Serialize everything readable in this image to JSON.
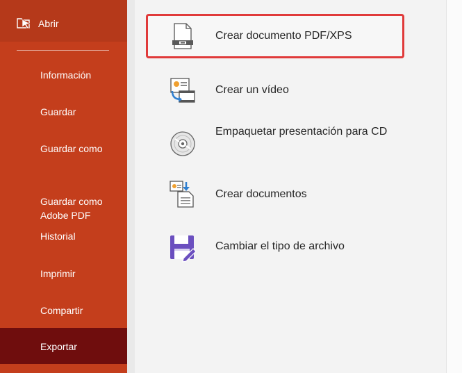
{
  "sidebar": {
    "open": {
      "label": "Abrir",
      "icon": "open-folder-icon"
    },
    "items": [
      {
        "label": "Información",
        "active": false
      },
      {
        "label": "Guardar",
        "active": false
      },
      {
        "label": "Guardar como",
        "active": false
      },
      {
        "label": "Guardar como\nAdobe PDF",
        "active": false
      },
      {
        "label": "Historial",
        "active": false
      },
      {
        "label": "Imprimir",
        "active": false
      },
      {
        "label": "Compartir",
        "active": false
      },
      {
        "label": "Exportar",
        "active": true
      }
    ]
  },
  "export_options": [
    {
      "label": "Crear documento PDF/XPS",
      "icon": "pdf-document-icon",
      "selected": true
    },
    {
      "label": "Crear un vídeo",
      "icon": "video-icon",
      "selected": false
    },
    {
      "label": "Empaquetar presentación para CD",
      "icon": "cd-icon",
      "selected": false
    },
    {
      "label": "Crear documentos",
      "icon": "handouts-icon",
      "selected": false
    },
    {
      "label": "Cambiar el tipo de archivo",
      "icon": "change-file-type-icon",
      "selected": false
    }
  ],
  "colors": {
    "sidebar_bg": "#c43e1c",
    "active_item_bg": "#6f0d0d",
    "highlight_border": "#e03a3a",
    "content_bg": "#f3f3f3"
  }
}
